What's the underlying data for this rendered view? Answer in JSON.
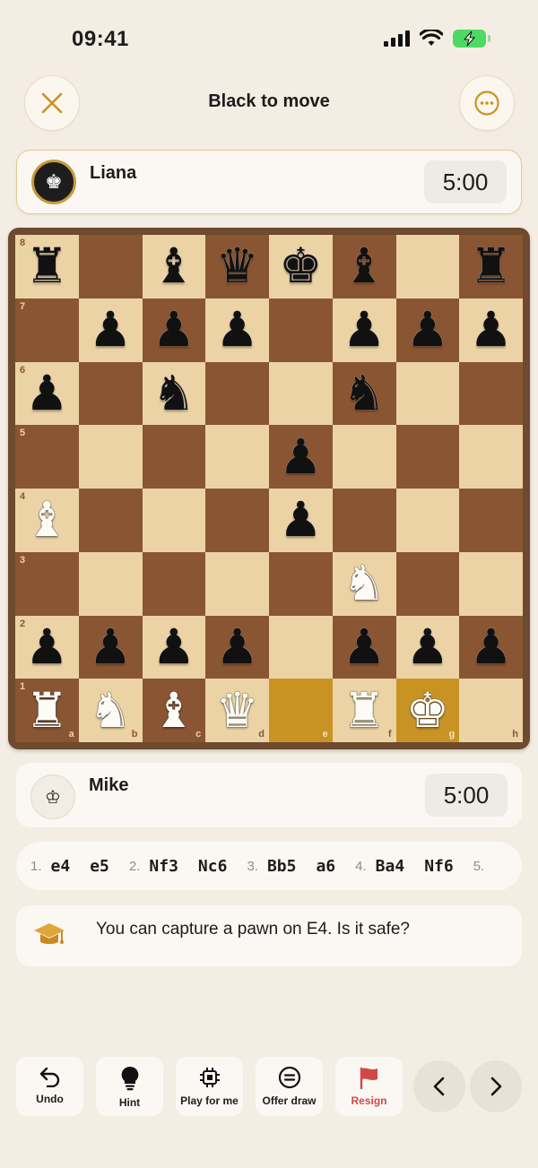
{
  "status": {
    "time": "09:41"
  },
  "header": {
    "title": "Black to move",
    "close_icon": "close-icon",
    "more_icon": "more-icon"
  },
  "player_top": {
    "name": "Liana",
    "clock": "5:00",
    "avatar_icon": "king-icon"
  },
  "player_bottom": {
    "name": "Mike",
    "clock": "5:00",
    "avatar_icon": "king-icon"
  },
  "board": {
    "files": [
      "a",
      "b",
      "c",
      "d",
      "e",
      "f",
      "g",
      "h"
    ],
    "ranks": [
      "8",
      "7",
      "6",
      "5",
      "4",
      "3",
      "2",
      "1"
    ],
    "highlight": [
      "e1",
      "g1"
    ],
    "rows": [
      [
        "bR",
        "",
        "bB",
        "bQ",
        "bK",
        "bB",
        "",
        "bR"
      ],
      [
        "",
        "bP",
        "bP",
        "bP",
        "",
        "bP",
        "bP",
        "bP"
      ],
      [
        "bP",
        "",
        "bN",
        "",
        "",
        "bN",
        "",
        ""
      ],
      [
        "",
        "",
        "",
        "",
        "bP",
        "",
        "",
        ""
      ],
      [
        "wB",
        "",
        "",
        "",
        "bP",
        "",
        "",
        ""
      ],
      [
        "",
        "",
        "",
        "",
        "",
        "wN",
        "",
        ""
      ],
      [
        "bP",
        "bP",
        "bP",
        "bP",
        "",
        "bP",
        "bP",
        "bP"
      ],
      [
        "wR",
        "wN",
        "wB",
        "wQ",
        "",
        "wR",
        "wK",
        ""
      ]
    ],
    "colors": {
      "light": "#ecd3a5",
      "dark": "#8a5532",
      "highlight": "#c99324"
    }
  },
  "moves": [
    {
      "num": "1.",
      "white": "e4",
      "black": "e5"
    },
    {
      "num": "2.",
      "white": "Nf3",
      "black": "Nc6"
    },
    {
      "num": "3.",
      "white": "Bb5",
      "black": "a6"
    },
    {
      "num": "4.",
      "white": "Ba4",
      "black": "Nf6"
    },
    {
      "num": "5.",
      "white": "",
      "black": ""
    }
  ],
  "hint": {
    "text": "You can capture a pawn on E4. Is it safe?",
    "icon": "graduation-cap-icon"
  },
  "toolbar": {
    "undo": "Undo",
    "hint": "Hint",
    "play_for_me": "Play for me",
    "offer_draw": "Offer draw",
    "resign": "Resign"
  }
}
